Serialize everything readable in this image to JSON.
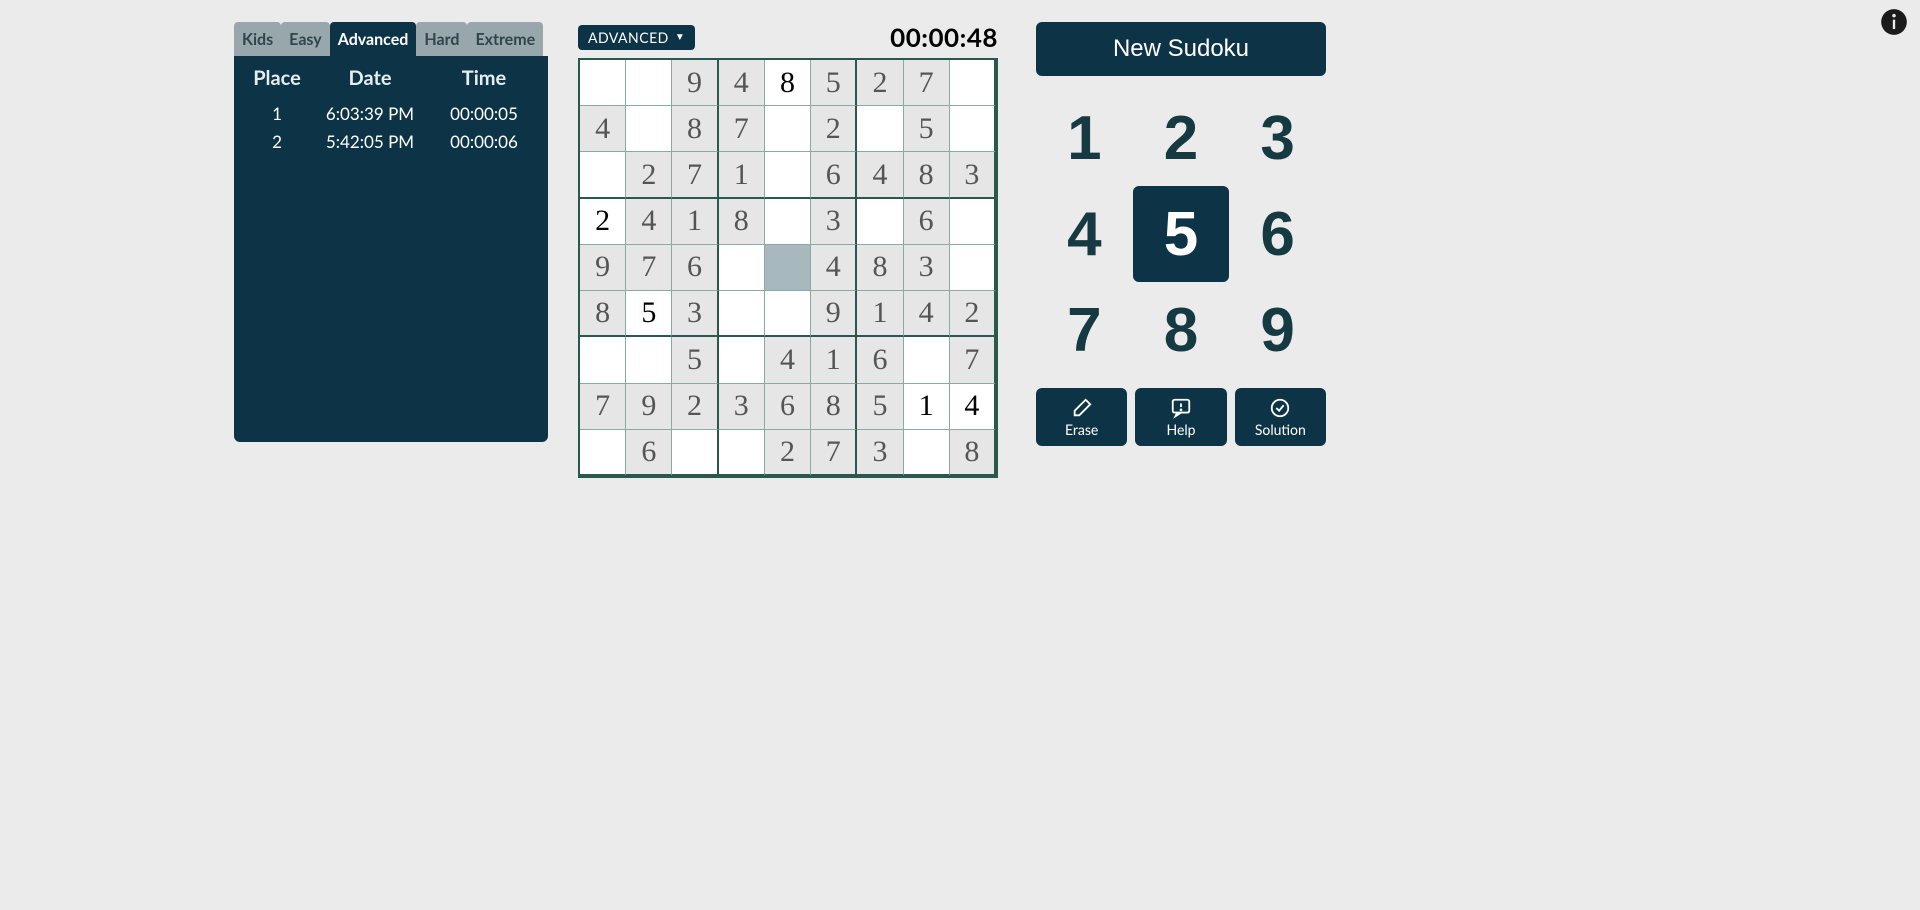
{
  "timer": "00:00:48",
  "difficulty_badge": "ADVANCED",
  "new_button": "New Sudoku",
  "tabs": [
    "Kids",
    "Easy",
    "Advanced",
    "Hard",
    "Extreme"
  ],
  "active_tab": 2,
  "score_header": {
    "place": "Place",
    "date": "Date",
    "time": "Time"
  },
  "scores": [
    {
      "place": "1",
      "date": "6:03:39 PM",
      "time": "00:00:05"
    },
    {
      "place": "2",
      "date": "5:42:05 PM",
      "time": "00:00:06"
    }
  ],
  "numpad": [
    "1",
    "2",
    "3",
    "4",
    "5",
    "6",
    "7",
    "8",
    "9"
  ],
  "selected_number_index": 4,
  "actions": {
    "erase": "Erase",
    "help": "Help",
    "solution": "Solution"
  },
  "selected_cell": [
    4,
    4
  ],
  "grid": [
    [
      null,
      null,
      {
        "v": "9",
        "g": true
      },
      {
        "v": "4",
        "g": true
      },
      {
        "v": "8",
        "g": false
      },
      {
        "v": "5",
        "g": true
      },
      {
        "v": "2",
        "g": true
      },
      {
        "v": "7",
        "g": true
      },
      null
    ],
    [
      {
        "v": "4",
        "g": true
      },
      null,
      {
        "v": "8",
        "g": true
      },
      {
        "v": "7",
        "g": true
      },
      null,
      {
        "v": "2",
        "g": true
      },
      null,
      {
        "v": "5",
        "g": true
      },
      null
    ],
    [
      null,
      {
        "v": "2",
        "g": true
      },
      {
        "v": "7",
        "g": true
      },
      {
        "v": "1",
        "g": true
      },
      null,
      {
        "v": "6",
        "g": true
      },
      {
        "v": "4",
        "g": true
      },
      {
        "v": "8",
        "g": true
      },
      {
        "v": "3",
        "g": true
      }
    ],
    [
      {
        "v": "2",
        "g": false
      },
      {
        "v": "4",
        "g": true
      },
      {
        "v": "1",
        "g": true
      },
      {
        "v": "8",
        "g": true
      },
      null,
      {
        "v": "3",
        "g": true
      },
      null,
      {
        "v": "6",
        "g": true
      },
      null
    ],
    [
      {
        "v": "9",
        "g": true
      },
      {
        "v": "7",
        "g": true
      },
      {
        "v": "6",
        "g": true
      },
      null,
      null,
      {
        "v": "4",
        "g": true
      },
      {
        "v": "8",
        "g": true
      },
      {
        "v": "3",
        "g": true
      },
      null
    ],
    [
      {
        "v": "8",
        "g": true
      },
      {
        "v": "5",
        "g": false
      },
      {
        "v": "3",
        "g": true
      },
      null,
      null,
      {
        "v": "9",
        "g": true
      },
      {
        "v": "1",
        "g": true
      },
      {
        "v": "4",
        "g": true
      },
      {
        "v": "2",
        "g": true
      }
    ],
    [
      null,
      null,
      {
        "v": "5",
        "g": true
      },
      null,
      {
        "v": "4",
        "g": true
      },
      {
        "v": "1",
        "g": true
      },
      {
        "v": "6",
        "g": true
      },
      null,
      {
        "v": "7",
        "g": true
      }
    ],
    [
      {
        "v": "7",
        "g": true
      },
      {
        "v": "9",
        "g": true
      },
      {
        "v": "2",
        "g": true
      },
      {
        "v": "3",
        "g": true
      },
      {
        "v": "6",
        "g": true
      },
      {
        "v": "8",
        "g": true
      },
      {
        "v": "5",
        "g": true
      },
      {
        "v": "1",
        "g": false
      },
      {
        "v": "4",
        "g": false
      }
    ],
    [
      null,
      {
        "v": "6",
        "g": true
      },
      null,
      null,
      {
        "v": "2",
        "g": true
      },
      {
        "v": "7",
        "g": true
      },
      {
        "v": "3",
        "g": true
      },
      null,
      {
        "v": "8",
        "g": true
      }
    ]
  ]
}
